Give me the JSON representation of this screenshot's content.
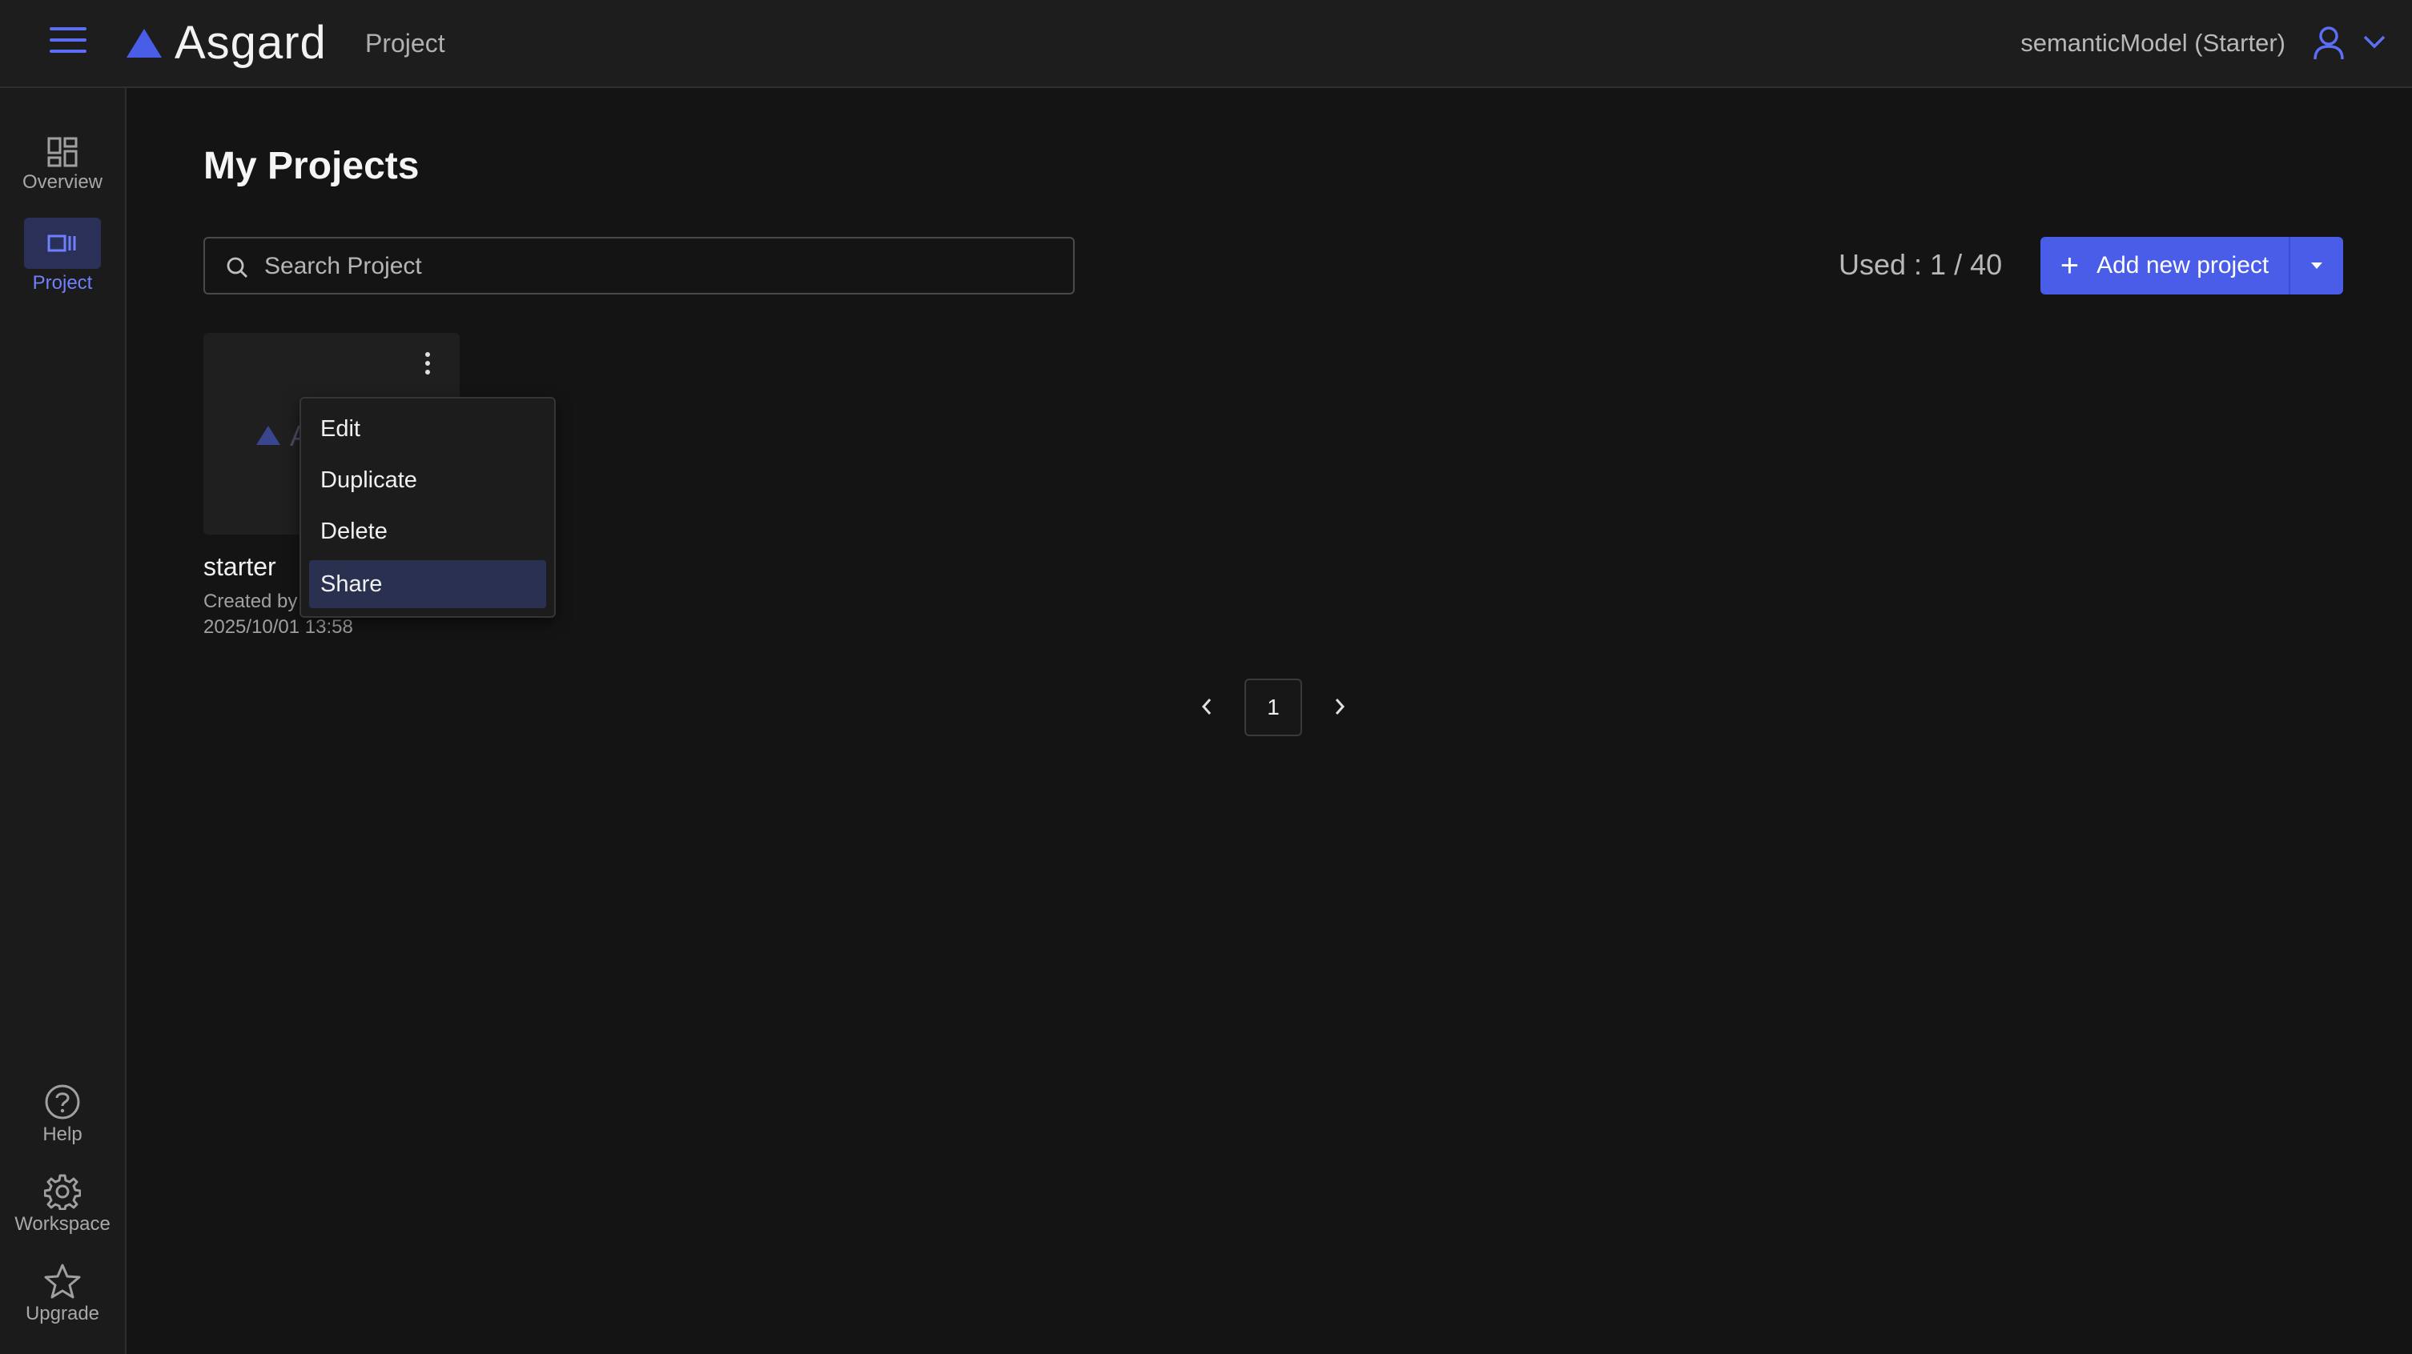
{
  "header": {
    "logo_text": "Asgard",
    "section": "Project",
    "account": "semanticModel (Starter)"
  },
  "sidebar": {
    "top_items": [
      {
        "label": "Overview",
        "icon": "grid-icon"
      },
      {
        "label": "Project",
        "icon": "project-icon",
        "active": true
      }
    ],
    "bottom_items": [
      {
        "label": "Help",
        "icon": "help-icon"
      },
      {
        "label": "Workspace",
        "icon": "gear-icon"
      },
      {
        "label": "Upgrade",
        "icon": "star-icon"
      }
    ]
  },
  "main": {
    "title": "My Projects",
    "search": {
      "placeholder": "Search Project",
      "value": ""
    },
    "used": "Used : 1 / 40",
    "add_button": "Add new project"
  },
  "projects": [
    {
      "name": "starter",
      "created_by": "Created by",
      "date": "2025/10/01 13:58",
      "thumb_text": "A"
    }
  ],
  "context_menu": {
    "items": [
      "Edit",
      "Duplicate",
      "Delete",
      "Share"
    ],
    "highlighted": "Share"
  },
  "pagination": {
    "current": "1"
  },
  "colors": {
    "accent": "#4a5de8",
    "background": "#141414",
    "surface": "#1d1d1d",
    "active_nav_bg": "#2a3058"
  }
}
